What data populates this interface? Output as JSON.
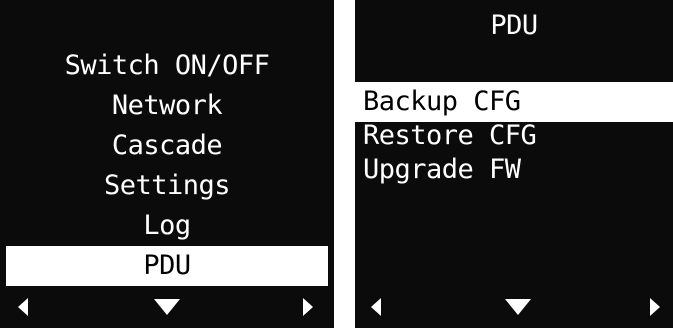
{
  "left_screen": {
    "menu": [
      {
        "label": "Switch ON/OFF"
      },
      {
        "label": "Network"
      },
      {
        "label": "Cascade"
      },
      {
        "label": "Settings"
      },
      {
        "label": "Log"
      },
      {
        "label": "PDU",
        "selected": true
      }
    ],
    "nav": {
      "left_icon": "triangle-left-icon",
      "down_icon": "triangle-down-icon",
      "right_icon": "triangle-right-icon"
    }
  },
  "right_screen": {
    "title": "PDU",
    "menu": [
      {
        "label": "Backup CFG",
        "selected": true
      },
      {
        "label": "Restore CFG"
      },
      {
        "label": "Upgrade FW"
      }
    ],
    "nav": {
      "left_icon": "triangle-left-icon",
      "down_icon": "triangle-down-icon",
      "right_icon": "triangle-right-icon"
    }
  },
  "colors": {
    "screen_bg": "#0b0b0b",
    "text": "#ffffff",
    "highlight_bg": "#ffffff",
    "highlight_text": "#000000"
  }
}
